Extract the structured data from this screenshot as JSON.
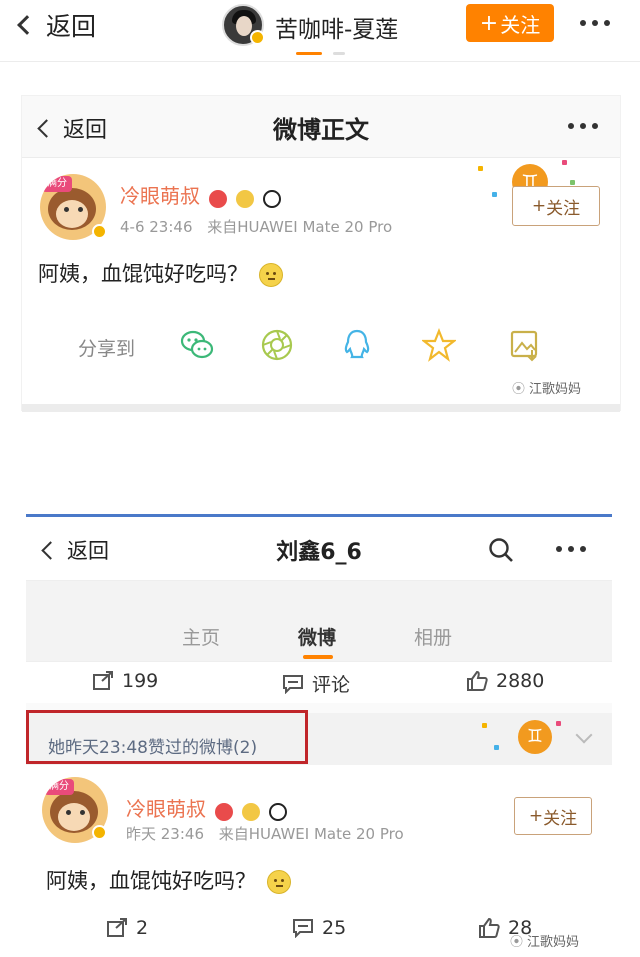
{
  "topbar": {
    "back_label": "返回",
    "profile_name": "苦咖啡-夏莲",
    "follow_label": "关注"
  },
  "card1": {
    "back_label": "返回",
    "title": "微博正文",
    "post": {
      "author": "冷眼萌叔",
      "avatar_tag": "满分",
      "time": "4-6 23:46",
      "source": "来自HUAWEI Mate 20 Pro",
      "text": "阿姨，血馄饨好吃吗？",
      "follow_label": "关注",
      "zodiac_symbol": "♊"
    },
    "share": {
      "label": "分享到",
      "icons": [
        "wechat-icon",
        "moments-icon",
        "qq-icon",
        "favorite-icon",
        "save-image-icon"
      ]
    },
    "watermark": "江歌妈妈"
  },
  "card2": {
    "back_label": "返回",
    "title": "刘鑫6_6",
    "tabs": [
      {
        "label": "主页",
        "active": false
      },
      {
        "label": "微博",
        "active": true
      },
      {
        "label": "相册",
        "active": false
      }
    ],
    "actions_top": {
      "repost": "199",
      "comment": "评论",
      "like": "2880"
    },
    "liked_header": "她昨天23:48赞过的微博(2)",
    "post": {
      "author": "冷眼萌叔",
      "avatar_tag": "满分",
      "time": "昨天 23:46",
      "source": "来自HUAWEI Mate 20 Pro",
      "text": "阿姨，血馄饨好吃吗？",
      "follow_label": "关注",
      "zodiac_symbol": "♊"
    },
    "actions_bottom": {
      "repost": "2",
      "comment": "25",
      "like": "28"
    },
    "watermark": "江歌妈妈"
  },
  "colors": {
    "brand_orange": "#ff8200",
    "username": "#eb7350",
    "highlight_box": "#c0262a",
    "divider_blue": "#4a79c9"
  }
}
